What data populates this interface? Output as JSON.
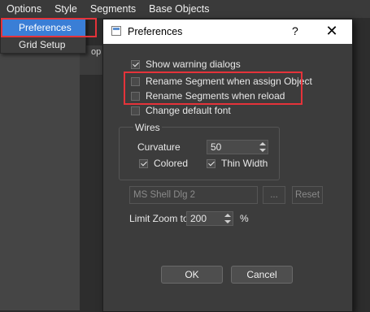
{
  "menubar": {
    "items": [
      "Options",
      "Style",
      "Segments",
      "Base Objects"
    ]
  },
  "workspace": {
    "strip_text": "op"
  },
  "options_menu": {
    "items": [
      "Preferences",
      "Grid Setup"
    ]
  },
  "dialog": {
    "title": "Preferences",
    "help": "?",
    "close": "✕",
    "checkboxes": [
      {
        "label": "Show warning dialogs",
        "checked": true
      },
      {
        "label": "Rename Segment when assign Object",
        "checked": false
      },
      {
        "label": "Rename Segments when reload",
        "checked": false
      },
      {
        "label": "Change default font",
        "checked": false
      }
    ],
    "wires": {
      "title": "Wires",
      "curvature_label": "Curvature",
      "curvature_value": "50",
      "colored_label": "Colored",
      "colored_checked": true,
      "thin_width_label": "Thin Width",
      "thin_width_checked": true
    },
    "font_field": "MS Shell Dlg 2",
    "browse_label": "...",
    "reset_label": "Reset",
    "limit_zoom": {
      "label": "Limit Zoom to",
      "value": "200",
      "unit": "%"
    },
    "ok_label": "OK",
    "cancel_label": "Cancel"
  },
  "highlight_color": "#e5333a",
  "selection_color": "#3a7ed6"
}
